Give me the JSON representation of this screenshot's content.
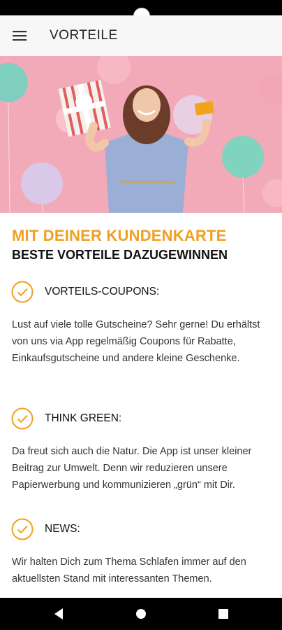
{
  "app_bar": {
    "title": "VORTEILE",
    "menu_icon": "hamburger-menu-icon"
  },
  "hero": {
    "description_icon": "hero-image"
  },
  "content": {
    "headline": "MIT DEINER KUNDENKARTE",
    "subheadline": "BESTE VORTEILE DAZUGEWINNEN",
    "sections": [
      {
        "title": "VORTEILS-COUPONS:",
        "text": "Lust auf viele tolle Gutscheine? Sehr gerne! Du erhältst von uns via App regelmäßig Coupons für Rabatte, Einkaufsgutscheine und andere kleine Geschenke."
      },
      {
        "title": "THINK GREEN:",
        "text": "Da freut sich auch die Natur. Die App ist unser kleiner Beitrag zur Umwelt. Denn wir reduzieren unsere Papierwerbung und kommunizieren „grün“ mit Dir."
      },
      {
        "title": "NEWS:",
        "text": "Wir halten Dich zum Thema Schlafen immer auf den aktuellsten Stand mit interessanten Themen."
      }
    ]
  },
  "colors": {
    "accent": "#f0a020",
    "hero_bg": "#f2aab8"
  },
  "nav": {
    "back_icon": "back-icon",
    "home_icon": "home-icon",
    "recents_icon": "recents-icon"
  }
}
